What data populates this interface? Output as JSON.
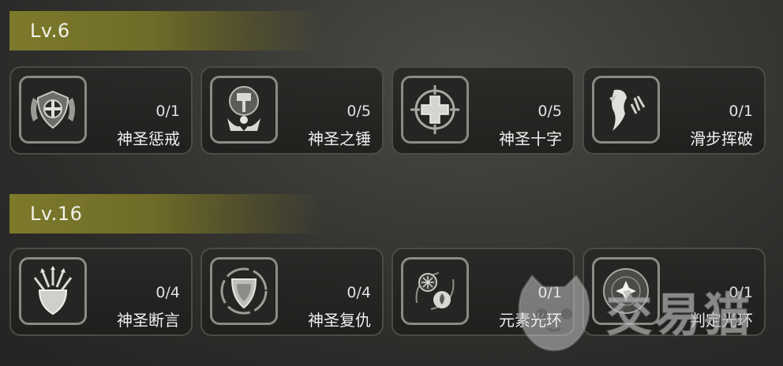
{
  "levels": [
    {
      "label": "Lv.6",
      "skills": [
        {
          "icon": "shield-cross-icon",
          "count": "0/1",
          "name": "神圣惩戒"
        },
        {
          "icon": "hammer-icon",
          "count": "0/5",
          "name": "神圣之锤"
        },
        {
          "icon": "holy-cross-icon",
          "count": "0/5",
          "name": "神圣十字"
        },
        {
          "icon": "slide-strike-icon",
          "count": "0/1",
          "name": "滑步挥破"
        }
      ]
    },
    {
      "label": "Lv.16",
      "skills": [
        {
          "icon": "shield-arrows-icon",
          "count": "0/4",
          "name": "神圣断言"
        },
        {
          "icon": "shield-swirl-icon",
          "count": "0/4",
          "name": "神圣复仇"
        },
        {
          "icon": "elemental-aura-icon",
          "count": "0/1",
          "name": "元素光环"
        },
        {
          "icon": "star-aura-icon",
          "count": "0/1",
          "name": "判定光环"
        }
      ]
    }
  ],
  "watermark": {
    "text": "交易猫",
    "icon": "cat-logo-icon"
  }
}
